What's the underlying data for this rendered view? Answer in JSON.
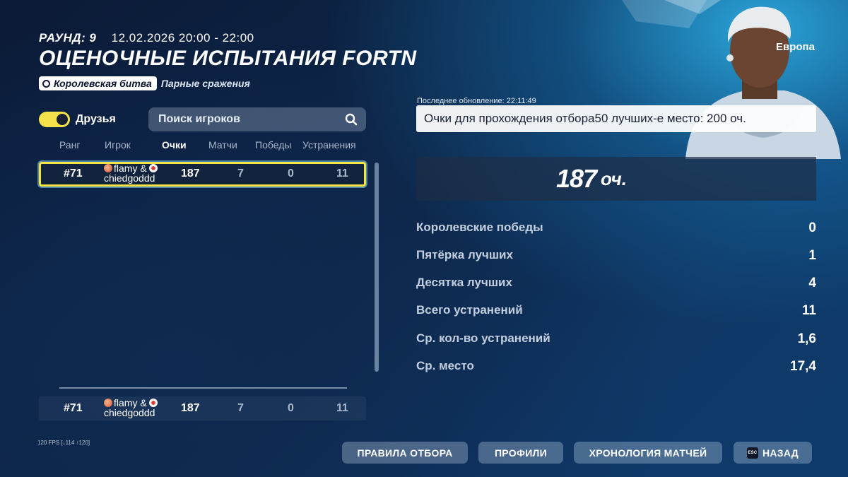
{
  "header": {
    "round_label": "РАУНД: 9",
    "datetime": "12.02.2026 20:00 - 22:00",
    "title": "ОЦЕНОЧНЫЕ ИСПЫТАНИЯ FORTNITE",
    "mode": "Королевская битва",
    "submode": "Парные сражения"
  },
  "filter": {
    "friends_label": "Друзья",
    "friends_on": true,
    "search_placeholder": "Поиск игроков"
  },
  "table": {
    "columns": [
      "Ранг",
      "Игрок",
      "Очки",
      "Матчи",
      "Победы",
      "Устранения"
    ],
    "active_column": "Очки",
    "rows": [
      {
        "rank": "#71",
        "player_line1": "flamy &",
        "player_line2": "chiedgoddd",
        "points": "187",
        "matches": "7",
        "wins": "0",
        "elims": "11"
      }
    ],
    "pinned": {
      "rank": "#71",
      "player_line1": "flamy &",
      "player_line2": "chiedgoddd",
      "points": "187",
      "matches": "7",
      "wins": "0",
      "elims": "11"
    }
  },
  "summary": {
    "last_updated": "Последнее обновление: 22:11:49",
    "threshold": "Очки для прохождения отбора50 лучших-е место: 200 оч.",
    "score": "187",
    "score_unit": "оч.",
    "region": "Европа",
    "stats": [
      {
        "label": "Королевские победы",
        "value": "0"
      },
      {
        "label": "Пятёрка лучших",
        "value": "1"
      },
      {
        "label": "Десятка лучших",
        "value": "4"
      },
      {
        "label": "Всего устранений",
        "value": "11"
      },
      {
        "label": "Ср. кол-во устранений",
        "value": "1,6"
      },
      {
        "label": "Ср. место",
        "value": "17,4"
      }
    ]
  },
  "footer": {
    "fps": "120 FPS [↓114 ↑120]",
    "buttons": {
      "rules": "ПРАВИЛА ОТБОРА",
      "profiles": "ПРОФИЛИ",
      "history": "ХРОНОЛОГИЯ МАТЧЕЙ",
      "back": "НАЗАД",
      "esc_key": "ESC"
    }
  }
}
